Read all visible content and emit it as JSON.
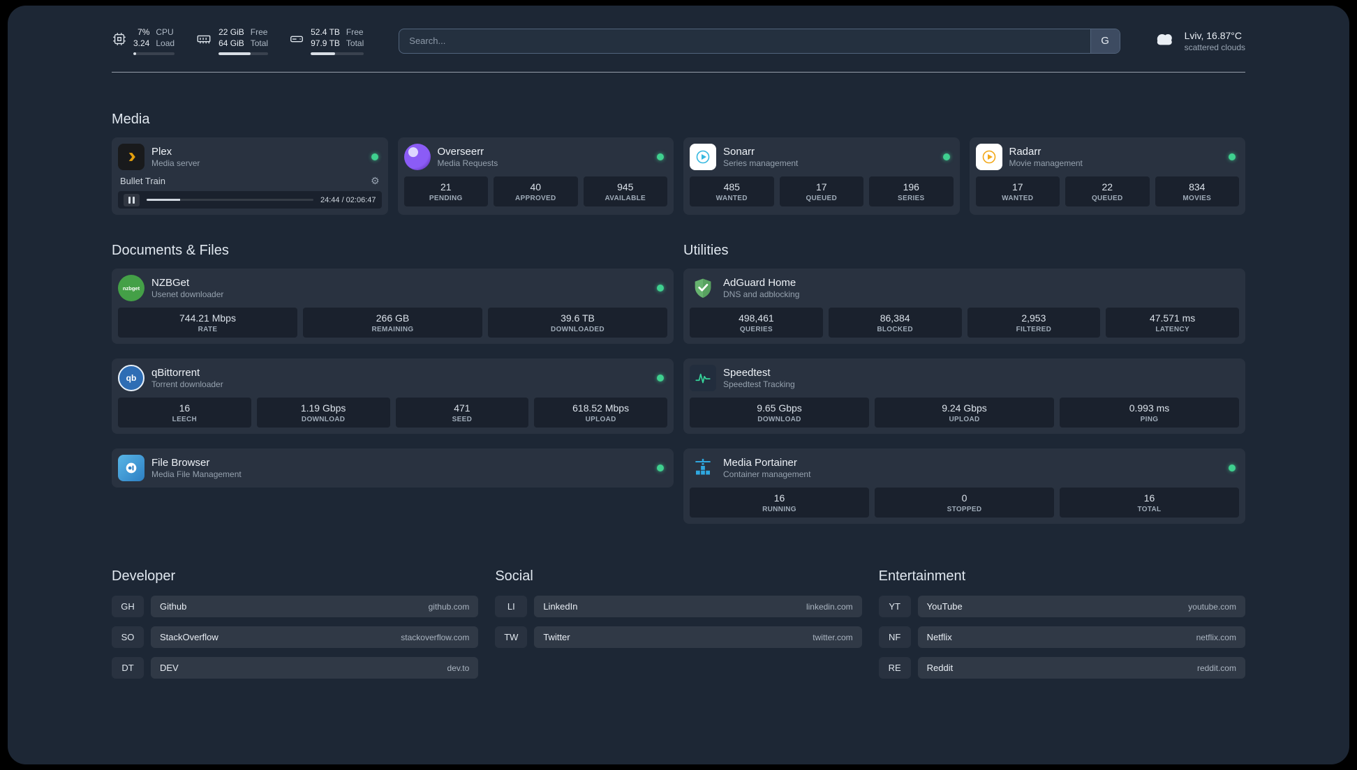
{
  "colors": {
    "background": "#1d2735",
    "status_green": "#3fd08f",
    "accent_amber": "#e5a00d"
  },
  "topbar": {
    "cpu": {
      "value": "7%",
      "load": "3.24",
      "label1": "CPU",
      "label2": "Load",
      "used_percent": 7
    },
    "ram": {
      "free": "22 GiB",
      "total": "64 GiB",
      "label1": "Free",
      "label2": "Total",
      "used_percent": 65
    },
    "disk": {
      "free": "52.4 TB",
      "total": "97.9 TB",
      "label1": "Free",
      "label2": "Total",
      "used_percent": 46
    },
    "search": {
      "placeholder": "Search...",
      "provider_label": "G"
    },
    "weather": {
      "location": "Lviv, 16.87°C",
      "condition": "scattered clouds"
    }
  },
  "media": {
    "title": "Media",
    "plex": {
      "name": "Plex",
      "subtitle": "Media server",
      "now_playing": "Bullet Train",
      "time": "24:44 / 02:06:47",
      "progress_percent": 20
    },
    "overseerr": {
      "name": "Overseerr",
      "subtitle": "Media Requests",
      "stats": [
        {
          "value": "21",
          "label": "PENDING"
        },
        {
          "value": "40",
          "label": "APPROVED"
        },
        {
          "value": "945",
          "label": "AVAILABLE"
        }
      ]
    },
    "sonarr": {
      "name": "Sonarr",
      "subtitle": "Series management",
      "stats": [
        {
          "value": "485",
          "label": "WANTED"
        },
        {
          "value": "17",
          "label": "QUEUED"
        },
        {
          "value": "196",
          "label": "SERIES"
        }
      ]
    },
    "radarr": {
      "name": "Radarr",
      "subtitle": "Movie management",
      "stats": [
        {
          "value": "17",
          "label": "WANTED"
        },
        {
          "value": "22",
          "label": "QUEUED"
        },
        {
          "value": "834",
          "label": "MOVIES"
        }
      ]
    }
  },
  "documents": {
    "title": "Documents & Files",
    "nzbget": {
      "name": "NZBGet",
      "subtitle": "Usenet downloader",
      "icon_text": "nzbget",
      "stats": [
        {
          "value": "744.21 Mbps",
          "label": "RATE"
        },
        {
          "value": "266 GB",
          "label": "REMAINING"
        },
        {
          "value": "39.6 TB",
          "label": "DOWNLOADED"
        }
      ]
    },
    "qbittorrent": {
      "name": "qBittorrent",
      "subtitle": "Torrent downloader",
      "icon_text": "qb",
      "stats": [
        {
          "value": "16",
          "label": "LEECH"
        },
        {
          "value": "1.19 Gbps",
          "label": "DOWNLOAD"
        },
        {
          "value": "471",
          "label": "SEED"
        },
        {
          "value": "618.52 Mbps",
          "label": "UPLOAD"
        }
      ]
    },
    "filebrowser": {
      "name": "File Browser",
      "subtitle": "Media File Management"
    }
  },
  "utilities": {
    "title": "Utilities",
    "adguard": {
      "name": "AdGuard Home",
      "subtitle": "DNS and adblocking",
      "stats": [
        {
          "value": "498,461",
          "label": "QUERIES"
        },
        {
          "value": "86,384",
          "label": "BLOCKED"
        },
        {
          "value": "2,953",
          "label": "FILTERED"
        },
        {
          "value": "47.571 ms",
          "label": "LATENCY"
        }
      ]
    },
    "speedtest": {
      "name": "Speedtest",
      "subtitle": "Speedtest Tracking",
      "stats": [
        {
          "value": "9.65 Gbps",
          "label": "DOWNLOAD"
        },
        {
          "value": "9.24 Gbps",
          "label": "UPLOAD"
        },
        {
          "value": "0.993 ms",
          "label": "PING"
        }
      ]
    },
    "portainer": {
      "name": "Media Portainer",
      "subtitle": "Container management",
      "stats": [
        {
          "value": "16",
          "label": "RUNNING"
        },
        {
          "value": "0",
          "label": "STOPPED"
        },
        {
          "value": "16",
          "label": "TOTAL"
        }
      ]
    }
  },
  "bookmarks": {
    "developer": {
      "title": "Developer",
      "items": [
        {
          "abbr": "GH",
          "name": "Github",
          "url": "github.com"
        },
        {
          "abbr": "SO",
          "name": "StackOverflow",
          "url": "stackoverflow.com"
        },
        {
          "abbr": "DT",
          "name": "DEV",
          "url": "dev.to"
        }
      ]
    },
    "social": {
      "title": "Social",
      "items": [
        {
          "abbr": "LI",
          "name": "LinkedIn",
          "url": "linkedin.com"
        },
        {
          "abbr": "TW",
          "name": "Twitter",
          "url": "twitter.com"
        }
      ]
    },
    "entertainment": {
      "title": "Entertainment",
      "items": [
        {
          "abbr": "YT",
          "name": "YouTube",
          "url": "youtube.com"
        },
        {
          "abbr": "NF",
          "name": "Netflix",
          "url": "netflix.com"
        },
        {
          "abbr": "RE",
          "name": "Reddit",
          "url": "reddit.com"
        }
      ]
    }
  }
}
